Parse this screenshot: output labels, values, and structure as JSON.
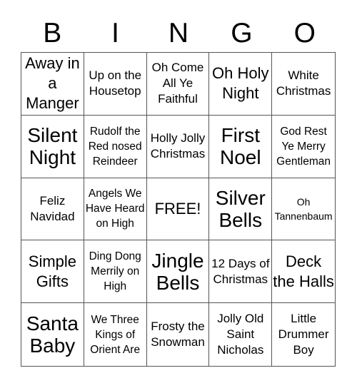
{
  "header": {
    "letters": [
      "B",
      "I",
      "N",
      "G",
      "O"
    ]
  },
  "cells": [
    {
      "text": "Away in a Manger",
      "size": "l"
    },
    {
      "text": "Up on the Housetop",
      "size": "m"
    },
    {
      "text": "Oh Come All Ye Faithful",
      "size": "m"
    },
    {
      "text": "Oh Holy Night",
      "size": "l"
    },
    {
      "text": "White Christmas",
      "size": "m"
    },
    {
      "text": "Silent Night",
      "size": "xl"
    },
    {
      "text": "Rudolf the Red nosed Reindeer",
      "size": "s"
    },
    {
      "text": "Holly Jolly Christmas",
      "size": "m"
    },
    {
      "text": "First Noel",
      "size": "xl"
    },
    {
      "text": "God Rest Ye Merry Gentleman",
      "size": "s"
    },
    {
      "text": "Feliz Navidad",
      "size": "m"
    },
    {
      "text": "Angels We Have Heard on High",
      "size": "s"
    },
    {
      "text": "FREE!",
      "size": "l"
    },
    {
      "text": "Silver Bells",
      "size": "xl"
    },
    {
      "text": "Oh Tannenbaum",
      "size": "xs"
    },
    {
      "text": "Simple Gifts",
      "size": "l"
    },
    {
      "text": "Ding Dong Merrily on High",
      "size": "s"
    },
    {
      "text": "Jingle Bells",
      "size": "xl"
    },
    {
      "text": "12 Days of Christmas",
      "size": "m"
    },
    {
      "text": "Deck the Halls",
      "size": "l"
    },
    {
      "text": "Santa Baby",
      "size": "xl"
    },
    {
      "text": "We Three Kings of Orient Are",
      "size": "s"
    },
    {
      "text": "Frosty the Snowman",
      "size": "m"
    },
    {
      "text": "Jolly Old Saint Nicholas",
      "size": "m"
    },
    {
      "text": "Little Drummer Boy",
      "size": "m"
    }
  ]
}
